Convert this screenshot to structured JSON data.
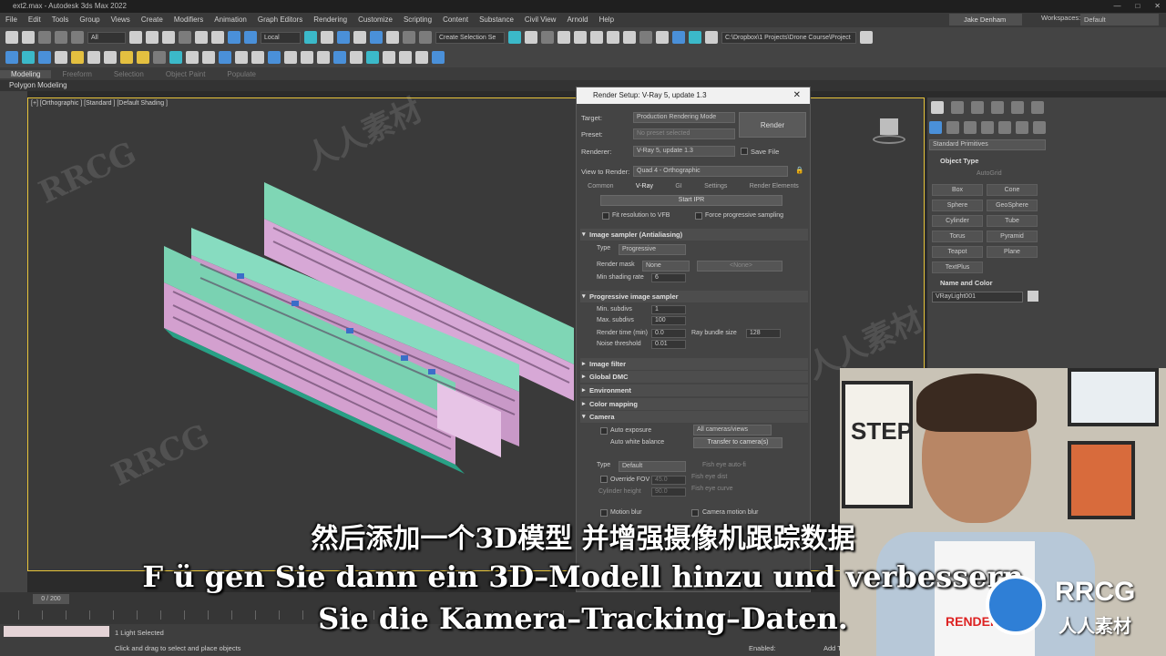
{
  "window": {
    "title": "ext2.max - Autodesk 3ds Max 2022"
  },
  "menu": [
    "File",
    "Edit",
    "Tools",
    "Group",
    "Views",
    "Create",
    "Modifiers",
    "Animation",
    "Graph Editors",
    "Rendering",
    "Customize",
    "Scripting",
    "Content",
    "Substance",
    "Civil View",
    "Arnold",
    "Help"
  ],
  "user": "Jake Denham",
  "workspaces_label": "Workspaces:",
  "workspaces_value": "Default",
  "toolbar": {
    "filter": "All",
    "ref_coord": "Local",
    "selection_set": "Create Selection Se",
    "path": "C:\\Dropbox\\1 Projects\\Drone Course\\Project"
  },
  "ribbon": {
    "tabs": [
      "Modeling",
      "Freeform",
      "Selection",
      "Object Paint",
      "Populate"
    ],
    "active": "Modeling",
    "sub": "Polygon Modeling"
  },
  "viewport": {
    "label": "[+] [Orthographic ] [Standard ] [Default Shading ]"
  },
  "render_setup": {
    "title": "Render Setup: V-Ray 5, update 1.3",
    "target_label": "Target:",
    "target": "Production Rendering Mode",
    "preset_label": "Preset:",
    "preset": "No preset selected",
    "renderer_label": "Renderer:",
    "renderer": "V-Ray 5, update 1.3",
    "save_file": "Save File",
    "view_label": "View to Render:",
    "view": "Quad 4 - Orthographic",
    "render_btn": "Render",
    "tabs": [
      "Common",
      "V-Ray",
      "GI",
      "Settings",
      "Render Elements"
    ],
    "start_ipr": "Start IPR",
    "fit_vfb": "Fit resolution to VFB",
    "force_prog": "Force progressive sampling",
    "image_sampler": {
      "title": "Image sampler (Antialiasing)",
      "type_label": "Type",
      "type": "Progressive",
      "mask_label": "Render mask",
      "mask": "None",
      "mask_none": "<None>",
      "min_rate_label": "Min shading rate",
      "min_rate": "6"
    },
    "progressive": {
      "title": "Progressive image sampler",
      "min_subdivs_label": "Min. subdivs",
      "min_subdivs": "1",
      "max_subdivs_label": "Max. subdivs",
      "max_subdivs": "100",
      "render_time_label": "Render time (min)",
      "render_time": "0.0",
      "bundle_label": "Ray bundle size",
      "bundle": "128",
      "noise_label": "Noise threshold",
      "noise": "0.01"
    },
    "rollouts": [
      "Image filter",
      "Global DMC",
      "Environment",
      "Color mapping"
    ],
    "camera": {
      "title": "Camera",
      "auto_exposure": "Auto exposure",
      "auto_wb": "Auto white balance",
      "all_cams": "All cameras/views",
      "transfer": "Transfer to camera(s)",
      "type_label": "Type",
      "type": "Default",
      "override_fov": "Override FOV",
      "fov": "45.0",
      "cyl_height": "Cylinder height",
      "cyl_val": "90.0",
      "fish_auto": "Fish eye auto-fi",
      "fish_dist": "Fish eye dist",
      "fish_curve": "Fish eye curve",
      "motion_blur": "Motion blur",
      "cam_motion_blur": "Camera motion blur"
    }
  },
  "command_panel": {
    "dropdown": "Standard Primitives",
    "object_type": "Object Type",
    "autogrid": "AutoGrid",
    "buttons": [
      "Box",
      "Cone",
      "Sphere",
      "GeoSphere",
      "Cylinder",
      "Tube",
      "Torus",
      "Pyramid",
      "Teapot",
      "Plane",
      "TextPlus"
    ],
    "name_color": "Name and Color",
    "name": "VRayLight001"
  },
  "timeline": {
    "frame": "0 / 200"
  },
  "status": {
    "selected": "1 Light Selected",
    "hint": "Click and drag to select and place objects",
    "enabled": "Enabled:",
    "add_t": "Add T"
  },
  "subtitles": {
    "zh": "然后添加一个3D模型 并增强摄像机跟踪数据",
    "de1": "F ü gen Sie dann ein 3D–Modell hinzu und verbessern",
    "de2": "Sie die Kamera–Tracking–Daten."
  },
  "watermark": {
    "logo_text": "RRCG",
    "logo_sub": "人人素材",
    "wm_text": "RRCG",
    "wm_cn": "人人素材"
  },
  "webcam": {
    "poster": "STEP",
    "shirt": "RENDER"
  }
}
